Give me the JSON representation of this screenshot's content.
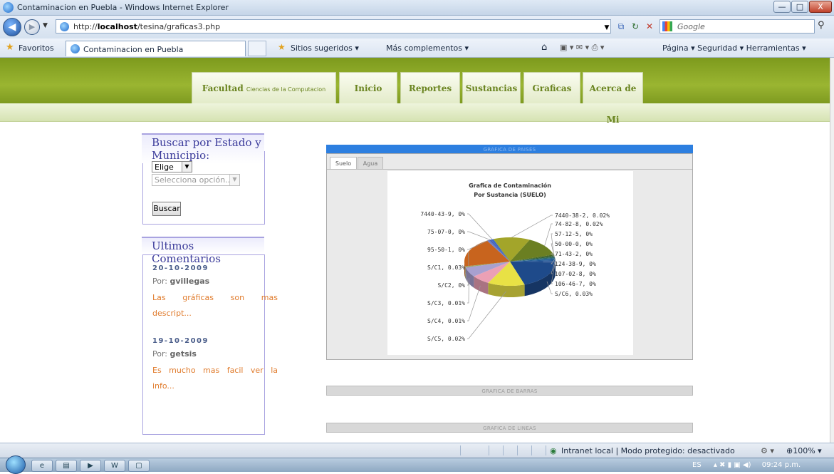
{
  "window": {
    "title": "Contaminacion en Puebla - Windows Internet Explorer",
    "min": "—",
    "max": "□",
    "close": "X"
  },
  "address": {
    "url_prefix": "http://",
    "url_host": "localhost",
    "url_path": "/tesina/graficas3.php",
    "search_placeholder": "Google"
  },
  "favbar": {
    "favorites": "Favoritos",
    "tab_title": "Contaminacion en Puebla",
    "suggested": "Sitios sugeridos ▾",
    "more_addons": "Más complementos ▾",
    "tools": "Página ▾   Seguridad ▾   Herramientas ▾"
  },
  "site_nav": {
    "faculty_bold": "Facultad",
    "faculty_small": "Ciencias de la Computacion",
    "items": [
      "Inicio",
      "Reportes",
      "Sustancias",
      "Graficas",
      "Acerca de Mi"
    ]
  },
  "search_box": {
    "title": "Buscar por Estado y Municipio:",
    "state_select": "Elige",
    "municipio_select": "Selecciona opción...",
    "button": "Buscar"
  },
  "comments": {
    "title": "Ultimos Comentarios",
    "by_label": "Por:",
    "items": [
      {
        "date": "20-10-2009",
        "author": "gvillegas",
        "text": "Las gráficas son mas descript..."
      },
      {
        "date": "19-10-2009",
        "author": "getsis",
        "text": "Es mucho mas facil ver la info..."
      }
    ]
  },
  "panels": {
    "countries": "GRAFICA DE PAISES",
    "bars": "GRAFICA DE BARRAS",
    "lines": "GRAFICA DE LINEAS"
  },
  "chart_tabs": [
    "Suelo",
    "Agua"
  ],
  "chart_data": {
    "type": "pie",
    "title": "Grafica de Contaminación",
    "subtitle": "Por Sustancia (SUELO)",
    "slices": [
      {
        "label": "7440-38-2",
        "value": 0.02,
        "color": "#a3a52a"
      },
      {
        "label": "74-82-8",
        "value": 0.02,
        "color": "#6b7f22"
      },
      {
        "label": "57-12-5",
        "value": 0,
        "color": "#446622"
      },
      {
        "label": "50-00-0",
        "value": 0,
        "color": "#2d5f3a"
      },
      {
        "label": "71-43-2",
        "value": 0,
        "color": "#2e6a6a"
      },
      {
        "label": "124-38-9",
        "value": 0,
        "color": "#1f5f8a"
      },
      {
        "label": "107-02-8",
        "value": 0,
        "color": "#205a98"
      },
      {
        "label": "106-46-7",
        "value": 0,
        "color": "#1d4f92"
      },
      {
        "label": "S/C6",
        "value": 0.03,
        "color": "#1e4a8a"
      },
      {
        "label": "S/C5",
        "value": 0.02,
        "color": "#e8e145"
      },
      {
        "label": "S/C4",
        "value": 0.01,
        "color": "#eba0b5"
      },
      {
        "label": "S/C3",
        "value": 0.01,
        "color": "#a8a0d0"
      },
      {
        "label": "S/C2",
        "value": 0,
        "color": "#9aa86a"
      },
      {
        "label": "S/C1",
        "value": 0.03,
        "color": "#c8641e"
      },
      {
        "label": "95-50-1",
        "value": 0,
        "color": "#6f7fc8"
      },
      {
        "label": "75-07-0",
        "value": 0,
        "color": "#4a66b8"
      },
      {
        "label": "7440-43-9",
        "value": 0,
        "color": "#3a66c8"
      }
    ]
  },
  "status": {
    "zone": "Intranet local | Modo protegido: desactivado",
    "zoom": "100%"
  },
  "taskbar": {
    "lang": "ES",
    "time": "09:24 p.m."
  }
}
